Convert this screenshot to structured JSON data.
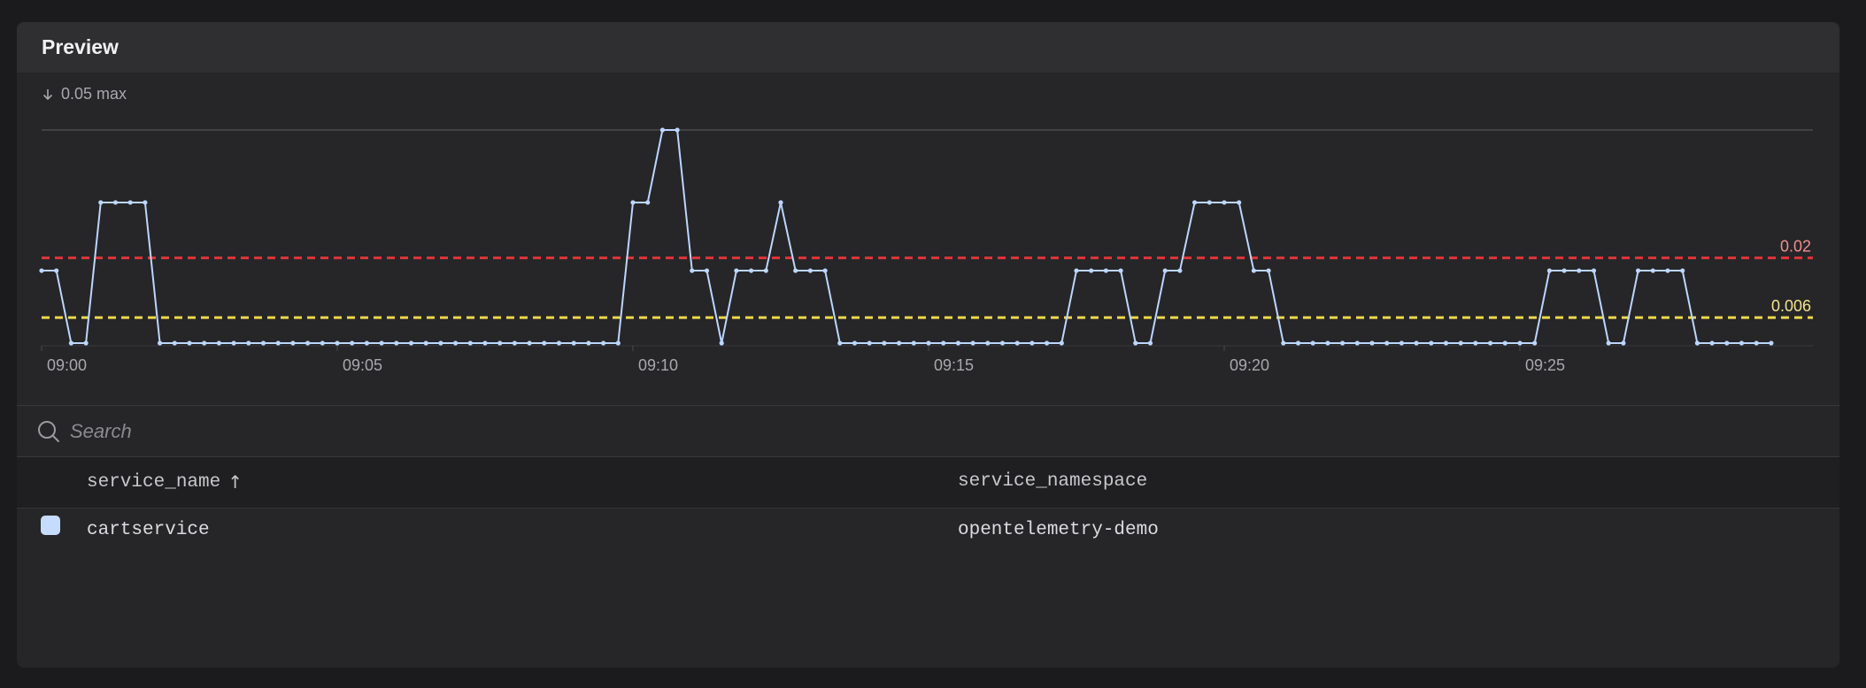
{
  "panel": {
    "title": "Preview"
  },
  "chart_data": {
    "type": "line",
    "max_label": "0.05 max",
    "y_max": 0.05,
    "x_tick_labels": [
      "09:00",
      "09:05",
      "09:10",
      "09:15",
      "09:20",
      "09:25"
    ],
    "x_tick_minutes": [
      0,
      5,
      10,
      15,
      20,
      25
    ],
    "x_step_minutes": 0.25,
    "line_color": "#bcd6ff",
    "series": [
      {
        "values": [
          0.017,
          0.017,
          0,
          0,
          0.033,
          0.033,
          0.033,
          0.033,
          0,
          0,
          0,
          0,
          0,
          0,
          0,
          0,
          0,
          0,
          0,
          0,
          0,
          0,
          0,
          0,
          0,
          0,
          0,
          0,
          0,
          0,
          0,
          0,
          0,
          0,
          0,
          0,
          0,
          0,
          0,
          0,
          0.033,
          0.033,
          0.05,
          0.05,
          0.017,
          0.017,
          0,
          0.017,
          0.017,
          0.017,
          0.033,
          0.017,
          0.017,
          0.017,
          0,
          0,
          0,
          0,
          0,
          0,
          0,
          0,
          0,
          0,
          0,
          0,
          0,
          0,
          0,
          0,
          0.017,
          0.017,
          0.017,
          0.017,
          0,
          0,
          0.017,
          0.017,
          0.033,
          0.033,
          0.033,
          0.033,
          0.017,
          0.017,
          0,
          0,
          0,
          0,
          0,
          0,
          0,
          0,
          0,
          0,
          0,
          0,
          0,
          0,
          0,
          0,
          0,
          0,
          0.017,
          0.017,
          0.017,
          0.017,
          0,
          0,
          0.017,
          0.017,
          0.017,
          0.017,
          0,
          0,
          0,
          0,
          0,
          0
        ]
      }
    ],
    "thresholds": [
      {
        "label": "0.02",
        "value": 0.02,
        "color": "#e0353a",
        "label_color": "#f08f8f"
      },
      {
        "label": "0.006",
        "value": 0.006,
        "color": "#eed94a",
        "label_color": "#f4e48a"
      }
    ]
  },
  "search": {
    "placeholder": "Search"
  },
  "table": {
    "columns": [
      {
        "label": "service_name",
        "sort": "asc"
      },
      {
        "label": "service_namespace"
      }
    ],
    "rows": [
      {
        "color": "#c6dcff",
        "service_name": "cartservice",
        "service_namespace": "opentelemetry-demo"
      }
    ]
  }
}
